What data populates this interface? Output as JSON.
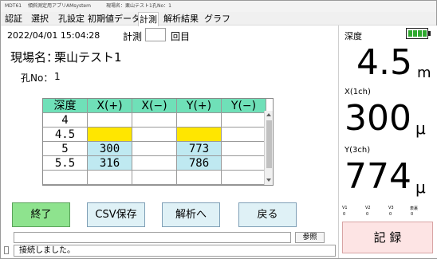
{
  "titlebar": {
    "app_name": "MDT61",
    "app_desc": "傾斜測定用アプリ",
    "company": "AMsystem",
    "site": "現場名：栗山テスト1",
    "hole": "孔No：1"
  },
  "menu": {
    "items": [
      {
        "label": "認証"
      },
      {
        "label": "選択"
      },
      {
        "label": "孔設定"
      },
      {
        "label": "初期値データ"
      },
      {
        "label": "計測"
      },
      {
        "label": "解析結果"
      },
      {
        "label": "グラフ"
      }
    ],
    "active_index": 4
  },
  "main": {
    "datetime": "2022/04/01 15:04:28",
    "measure_label": "計測",
    "measure_count_value": "",
    "times_suffix": "回目",
    "site_label": "現場名：",
    "site_value": "栗山テスト1",
    "hole_label": "孔No：",
    "hole_value": "1"
  },
  "table": {
    "headers": [
      "深度",
      "X(+)",
      "X(−)",
      "Y(+)",
      "Y(−)"
    ],
    "rows": [
      {
        "cells": [
          "4",
          "",
          "",
          "",
          ""
        ]
      },
      {
        "cells": [
          "4.5",
          "",
          "",
          "",
          ""
        ],
        "highlight": "current"
      },
      {
        "cells": [
          "5",
          "300",
          "",
          "773",
          ""
        ],
        "highlight": "filled"
      },
      {
        "cells": [
          "5.5",
          "316",
          "",
          "786",
          ""
        ],
        "highlight": "filled"
      }
    ],
    "colors": {
      "header": "#6fe0b8",
      "current": "#ffe600",
      "filled": "#bfe9f1"
    }
  },
  "buttons": {
    "end": "終了",
    "csv": "CSV保存",
    "analyze": "解析へ",
    "back": "戻る",
    "browse": "参照",
    "record": "記 録"
  },
  "status": {
    "message": "接続しました。",
    "path_value": ""
  },
  "right": {
    "depth_label": "深度",
    "depth_value": "4.5",
    "depth_unit": "m",
    "x_label": "X(1ch)",
    "x_value": "300",
    "x_unit": "μ",
    "y_label": "Y(3ch)",
    "y_value": "774",
    "y_unit": "μ",
    "battery_level": 1.0,
    "battery_color": "#2ea82e",
    "mini_labels": [
      "V1",
      "V2",
      "V3",
      "表裏"
    ],
    "mini_values": [
      "0",
      "0",
      "0",
      "0"
    ]
  }
}
